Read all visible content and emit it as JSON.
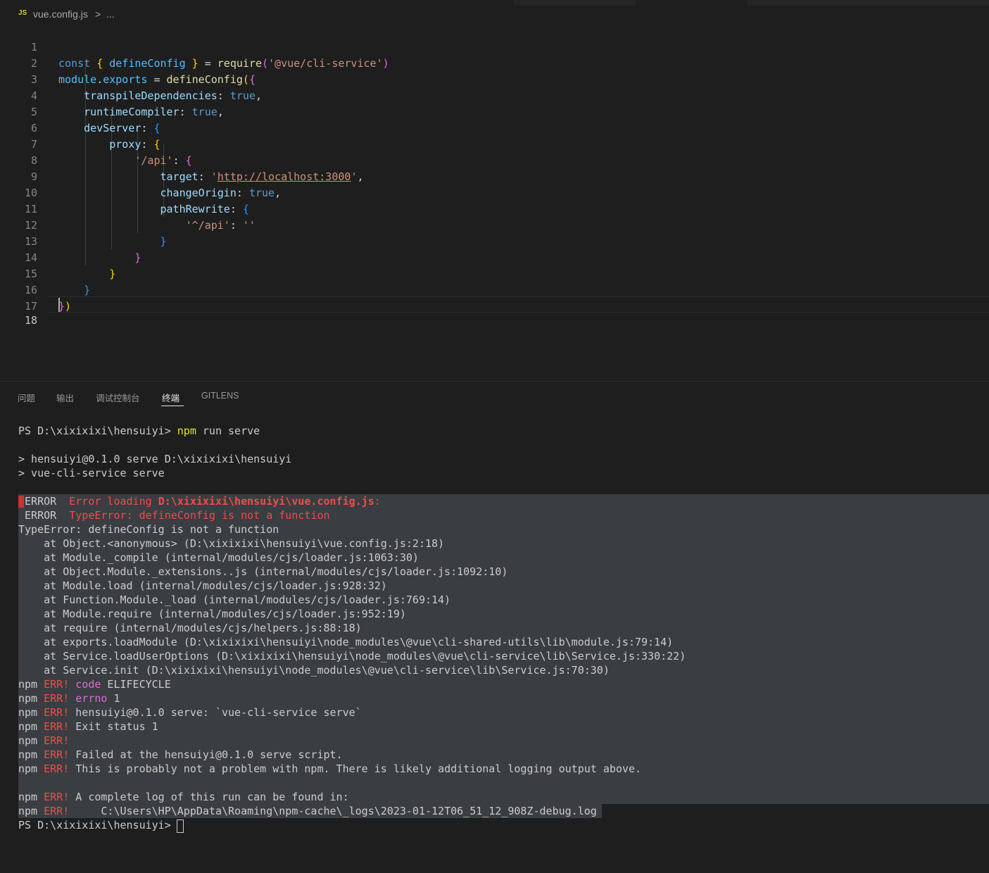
{
  "breadcrumb": {
    "badge": "JS",
    "file": "vue.config.js",
    "sep": ">",
    "more": "..."
  },
  "editor": {
    "line_numbers": [
      "1",
      "2",
      "3",
      "4",
      "5",
      "6",
      "7",
      "8",
      "9",
      "10",
      "11",
      "12",
      "13",
      "14",
      "15",
      "16",
      "17",
      "18"
    ],
    "code": {
      "l1": {
        "const": "const",
        "sp1": " ",
        "lb": "{",
        "dc": " defineConfig ",
        "rb": "}",
        "eq": " = ",
        "req": "require",
        "po": "(",
        "s": "'@vue/cli-service'",
        "pc": ")"
      },
      "l2": {
        "module": "module",
        "dot": ".",
        "exports": "exports",
        "eq": " = ",
        "fn": "defineConfig",
        "po": "(",
        "lb": "{"
      },
      "l3": {
        "indent": "    ",
        "key": "transpileDependencies",
        "colon": ": ",
        "val": "true",
        "comma": ","
      },
      "l4": {
        "indent": "    ",
        "key": "runtimeCompiler",
        "colon": ": ",
        "val": "true",
        "comma": ","
      },
      "l5": {
        "indent": "    ",
        "key": "devServer",
        "colon": ": ",
        "lb": "{"
      },
      "l6": {
        "indent": "        ",
        "key": "proxy",
        "colon": ": ",
        "lb": "{"
      },
      "l7": {
        "indent": "            ",
        "key": "'/api'",
        "colon": ": ",
        "lb": "{"
      },
      "l8": {
        "indent": "                ",
        "key": "target",
        "colon": ": ",
        "q1": "'",
        "url": "http://localhost:3000",
        "q2": "'",
        "comma": ","
      },
      "l9": {
        "indent": "                ",
        "key": "changeOrigin",
        "colon": ": ",
        "val": "true",
        "comma": ","
      },
      "l10": {
        "indent": "                ",
        "key": "pathRewrite",
        "colon": ": ",
        "lb": "{"
      },
      "l11": {
        "indent": "                    ",
        "key": "'^/api'",
        "colon": ": ",
        "val": "''"
      },
      "l12": {
        "indent": "                ",
        "rb": "}"
      },
      "l13": {
        "indent": "            ",
        "rb": "}"
      },
      "l14": {
        "indent": "        ",
        "rb": "}"
      },
      "l15": {
        "indent": "    ",
        "rb": "}"
      },
      "l16": {
        "rb": "}",
        "pc": ")"
      }
    }
  },
  "panel": {
    "tabs": [
      "问题",
      "输出",
      "调试控制台",
      "终端",
      "GITLENS"
    ],
    "active_tab": "终端"
  },
  "terminal": {
    "prompt1": "PS D:\\xixixixi\\hensuiyi> ",
    "cmd1": "npm",
    "cmd1_rest": " run serve",
    "info1": "> hensuiyi@0.1.0 serve D:\\xixixixi\\hensuiyi",
    "info2": "> vue-cli-service serve",
    "err1_label": " ERROR ",
    "err1_msg": " Error loading ",
    "err1_path": "D:\\xixixixi\\hensuiyi\\vue.config.js",
    "err1_colon": ":",
    "err2_label": " ERROR ",
    "err2_msg": " TypeError: defineConfig is not a function",
    "type_error": "TypeError: defineConfig is not a function",
    "stack": [
      "    at Object.<anonymous> (D:\\xixixixi\\hensuiyi\\vue.config.js:2:18)",
      "    at Module._compile (internal/modules/cjs/loader.js:1063:30)",
      "    at Object.Module._extensions..js (internal/modules/cjs/loader.js:1092:10)",
      "    at Module.load (internal/modules/cjs/loader.js:928:32)",
      "    at Function.Module._load (internal/modules/cjs/loader.js:769:14)",
      "    at Module.require (internal/modules/cjs/loader.js:952:19)",
      "    at require (internal/modules/cjs/helpers.js:88:18)",
      "    at exports.loadModule (D:\\xixixixi\\hensuiyi\\node_modules\\@vue\\cli-shared-utils\\lib\\module.js:79:14)",
      "    at Service.loadUserOptions (D:\\xixixixi\\hensuiyi\\node_modules\\@vue\\cli-service\\lib\\Service.js:330:22)",
      "    at Service.init (D:\\xixixixi\\hensuiyi\\node_modules\\@vue\\cli-service\\lib\\Service.js:70:30)"
    ],
    "npm": "npm ",
    "err": "ERR!",
    "npm_lines": [
      {
        "tag": " code",
        "text": " ELIFECYCLE"
      },
      {
        "tag": " errno",
        "text": " 1"
      },
      {
        "tag": "",
        "text": " hensuiyi@0.1.0 serve: `vue-cli-service serve`"
      },
      {
        "tag": "",
        "text": " Exit status 1"
      },
      {
        "tag": "",
        "text": ""
      },
      {
        "tag": "",
        "text": " Failed at the hensuiyi@0.1.0 serve script."
      },
      {
        "tag": "",
        "text": " This is probably not a problem with npm. There is likely additional logging output above."
      }
    ],
    "npm_log1": " A complete log of this run can be found in:",
    "npm_log2": "     C:\\Users\\HP\\AppData\\Roaming\\npm-cache\\_logs\\2023-01-12T06_51_12_908Z-debug.log",
    "prompt2": "PS D:\\xixixixi\\hensuiyi> "
  }
}
